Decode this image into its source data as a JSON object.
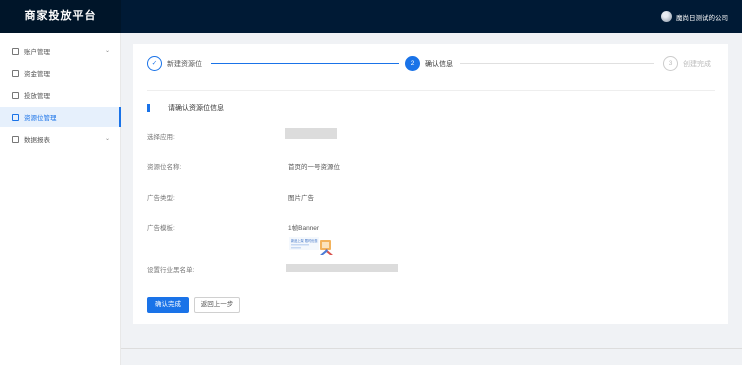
{
  "header": {
    "brand": "商家投放平台",
    "user_name": "魔尚日测试的公司"
  },
  "sidebar": {
    "items": [
      {
        "label": "账户管理",
        "icon": "account-icon",
        "has_arrow": true
      },
      {
        "label": "资金管理",
        "icon": "wallet-icon"
      },
      {
        "label": "投放管理",
        "icon": "campaign-icon"
      },
      {
        "label": "资源位管理",
        "icon": "grid-icon",
        "active": true
      },
      {
        "label": "数据报表",
        "icon": "report-icon",
        "has_arrow": true
      }
    ]
  },
  "steps": [
    {
      "num": "✓",
      "label": "新建资源位",
      "state": "done"
    },
    {
      "num": "2",
      "label": "确认信息",
      "state": "current"
    },
    {
      "num": "3",
      "label": "创建完成",
      "state": "pending"
    }
  ],
  "form": {
    "section_title": "请确认资源位信息",
    "fields": {
      "app_label": "选择应用:",
      "name_label": "资源位名称:",
      "name_value": "首页的一号资源位",
      "ad_type_label": "广告类型:",
      "ad_type_value": "图片广告",
      "template_label": "广告模板:",
      "template_value": "1帧Banner",
      "industry_label": "设置行业黑名单:"
    },
    "banner_text": "新品上架 限时优惠",
    "confirm_button": "确认完成",
    "back_button": "返回上一步"
  },
  "colors": {
    "primary": "#1a73e8",
    "header_bg": "#001a35"
  }
}
